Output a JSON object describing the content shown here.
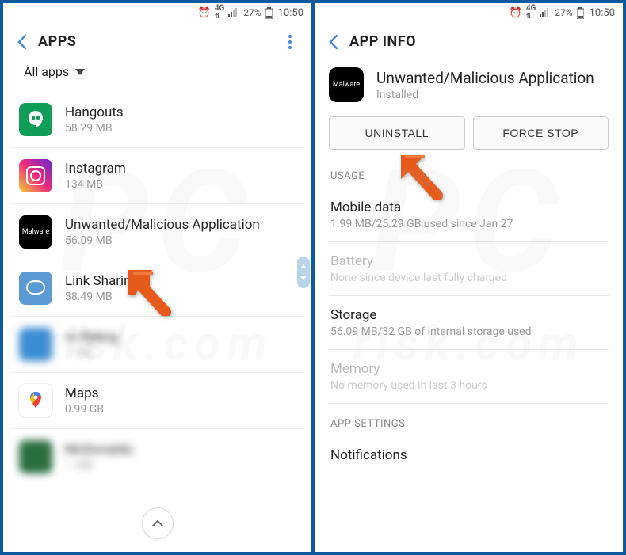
{
  "statusBar": {
    "network": "4G",
    "battery_pct": "27%",
    "time": "10:50"
  },
  "left": {
    "title": "APPS",
    "filter": "All apps",
    "apps": [
      {
        "name": "Hangouts",
        "size": "58.29 MB"
      },
      {
        "name": "Instagram",
        "size": "134 MB"
      },
      {
        "name": "Unwanted/Malicious Application",
        "size": "56.09 MB"
      },
      {
        "name": "Link Sharing",
        "size": "38.49 MB"
      },
      {
        "name": "",
        "size": ""
      },
      {
        "name": "Maps",
        "size": "0.99 GB"
      },
      {
        "name": "",
        "size": ""
      }
    ],
    "malware_icon_label": "Malware"
  },
  "right": {
    "title": "APP INFO",
    "app": {
      "name": "Unwanted/Malicious Application",
      "status": "Installed",
      "icon_label": "Malware"
    },
    "buttons": {
      "uninstall": "UNINSTALL",
      "forcestop": "FORCE STOP"
    },
    "sections": {
      "usage": "USAGE",
      "appsettings": "APP SETTINGS"
    },
    "rows": {
      "mobiledata": {
        "label": "Mobile data",
        "value": "1.99 MB/25.29 GB used since Jan 27"
      },
      "battery": {
        "label": "Battery",
        "value": "None since device last fully charged"
      },
      "storage": {
        "label": "Storage",
        "value": "56.09 MB/32 GB of internal storage used"
      },
      "memory": {
        "label": "Memory",
        "value": "No memory used in last 3 hours"
      },
      "notifications": {
        "label": "Notifications"
      }
    }
  },
  "watermark": {
    "big": "PC",
    "small": "risk.com"
  }
}
